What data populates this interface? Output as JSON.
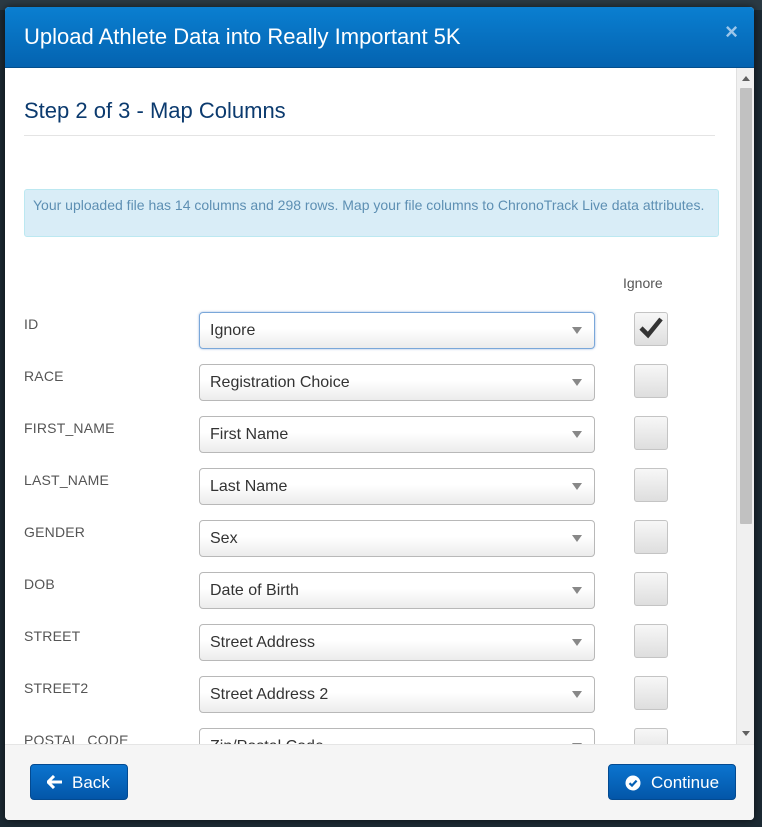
{
  "modal": {
    "title": "Upload Athlete Data into Really Important 5K",
    "close_glyph": "×"
  },
  "step": {
    "title": "Step 2 of 3 - Map Columns"
  },
  "info": {
    "text": "Your uploaded file has 14 columns and 298 rows. Map your file columns to ChronoTrack Live data attributes."
  },
  "ignore_header": "Ignore",
  "rows": [
    {
      "column": "ID",
      "mapping": "Ignore",
      "ignored": true
    },
    {
      "column": "RACE",
      "mapping": "Registration Choice",
      "ignored": false
    },
    {
      "column": "FIRST_NAME",
      "mapping": "First Name",
      "ignored": false
    },
    {
      "column": "LAST_NAME",
      "mapping": "Last Name",
      "ignored": false
    },
    {
      "column": "GENDER",
      "mapping": "Sex",
      "ignored": false
    },
    {
      "column": "DOB",
      "mapping": "Date of Birth",
      "ignored": false
    },
    {
      "column": "STREET",
      "mapping": "Street Address",
      "ignored": false
    },
    {
      "column": "STREET2",
      "mapping": "Street Address 2",
      "ignored": false
    },
    {
      "column": "POSTAL_CODE",
      "mapping": "Zip/Postal Code",
      "ignored": false
    }
  ],
  "footer": {
    "back_label": "Back",
    "continue_label": "Continue"
  },
  "colors": {
    "header_blue": "#0463b0",
    "button_blue": "#0356a8",
    "info_bg": "#d9edf7",
    "info_text": "#5d8fb3"
  }
}
